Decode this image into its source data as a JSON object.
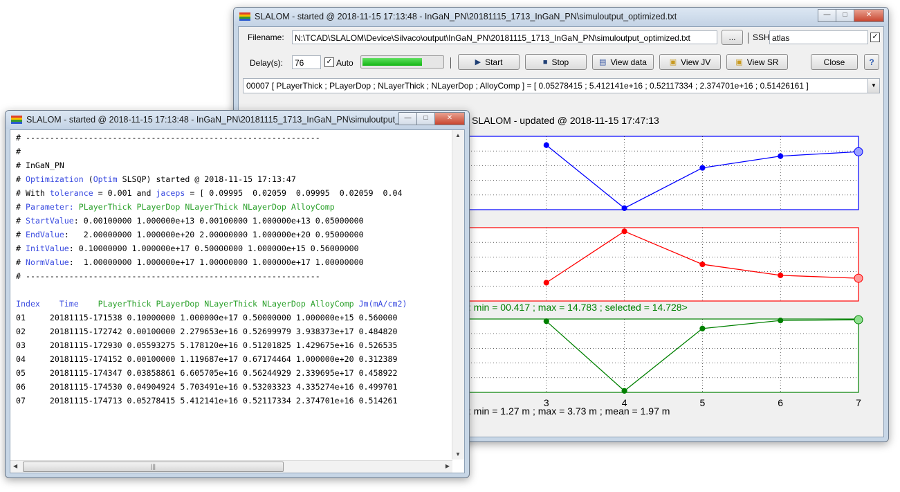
{
  "main_window": {
    "title": "SLALOM - started @ 2018-11-15 17:13:48 - InGaN_PN\\20181115_1713_InGaN_PN\\simuloutput_optimized.txt",
    "filename_label": "Filename:",
    "filename_value": "N:\\TCAD\\SLALOM\\Device\\Silvaco\\output\\InGaN_PN\\20181115_1713_InGaN_PN\\simuloutput_optimized.txt",
    "browse_label": "...",
    "ssh_label": "SSH:",
    "ssh_value": "atlas",
    "ssh_checked": true,
    "delay_label": "Delay(s):",
    "delay_value": "76",
    "auto_label": "Auto",
    "auto_checked": true,
    "progress": 0.75,
    "buttons": {
      "start": "Start",
      "stop": "Stop",
      "view_data": "View data",
      "view_jv": "View JV",
      "view_sr": "View SR",
      "close": "Close",
      "help": "?"
    },
    "iteration_combo": "00007  [ PLayerThick ; PLayerDop ; NLayerThick ; NLayerDop ; AlloyComp ]  =  [ 0.05278415 ; 5.412141e+16 ; 0.52117334 ; 2.374701e+16 ; 0.51426161 ]"
  },
  "chart_data": {
    "type": "line",
    "title": "SLALOM - updated @ 2018-11-15 17:47:13",
    "x": [
      3,
      4,
      5,
      6,
      7
    ],
    "xlim": [
      2,
      7
    ],
    "x_ticks": [
      "3",
      "4",
      "5",
      "6",
      "7"
    ],
    "grid": true,
    "series": [
      {
        "color": "#0000ff",
        "values": [
          0.88,
          0.02,
          0.57,
          0.73,
          0.79
        ]
      },
      {
        "color": "#ff0000",
        "values": [
          0.25,
          0.95,
          0.5,
          0.35,
          0.31
        ]
      },
      {
        "color": "#008000",
        "values": [
          0.97,
          0.02,
          0.87,
          0.98,
          0.99
        ]
      }
    ],
    "annotations": {
      "red_stats": ": min = 00.417 ; max = 14.783 ; selected = 14.728>",
      "green_stats": ": min = 1.27 m ; max = 3.73 m ; mean = 1.97 m"
    }
  },
  "log_window": {
    "title": "SLALOM - started @ 2018-11-15 17:13:48 - InGaN_PN\\20181115_1713_InGaN_PN\\simuloutput_optimiz...",
    "header": {
      "rule": "# -------------------------------------------------------------",
      "blank": "#",
      "project": "# InGaN_PN",
      "opt_hash": "# ",
      "opt_kw": "Optimization",
      "opt_p1": " (",
      "opt_kw2": "Optim",
      "opt_rest": " SLSQP) started @ 2018-11-15 17:13:47",
      "with_a": "# With ",
      "with_kw1": "tolerance",
      "with_b": " = 0.001 and ",
      "with_kw2": "jaceps",
      "with_c": " = [ 0.09995  0.02059  0.09995  0.02059  0.04",
      "param_hash": "# ",
      "param_kw": "Parameter:",
      "param_vals": " PLayerThick PLayerDop NLayerThick NLayerDop AlloyComp",
      "start_kw": "StartValue",
      "start_vals": ": 0.00100000 1.000000e+13 0.00100000 1.000000e+13 0.05000000",
      "end_kw": "EndValue",
      "end_vals": ":   2.00000000 1.000000e+20 2.00000000 1.000000e+20 0.95000000",
      "init_kw": "InitValue",
      "init_vals": ": 0.10000000 1.000000e+17 0.50000000 1.000000e+15 0.56000000",
      "norm_kw": "NormValue",
      "norm_vals": ":  1.00000000 1.000000e+17 1.00000000 1.000000e+17 1.00000000",
      "rule2": "# -------------------------------------------------------------"
    },
    "columns": [
      "Index",
      "Time",
      "PLayerThick",
      "PLayerDop",
      "NLayerThick",
      "NLayerDop",
      "AlloyComp",
      "Jm(mA/cm2)"
    ],
    "rows": [
      "01     20181115-171538 0.10000000 1.000000e+17 0.50000000 1.000000e+15 0.560000",
      "02     20181115-172742 0.00100000 2.279653e+16 0.52699979 3.938373e+17 0.484820",
      "03     20181115-172930 0.05593275 5.178120e+16 0.51201825 1.429675e+16 0.526535",
      "04     20181115-174152 0.00100000 1.119687e+17 0.67174464 1.000000e+20 0.312389",
      "05     20181115-174347 0.03858861 6.605705e+16 0.56244929 2.339695e+17 0.458922",
      "06     20181115-174530 0.04904924 5.703491e+16 0.53203323 4.335274e+16 0.499701",
      "07     20181115-174713 0.05278415 5.412141e+16 0.52117334 2.374701e+16 0.514261"
    ]
  }
}
